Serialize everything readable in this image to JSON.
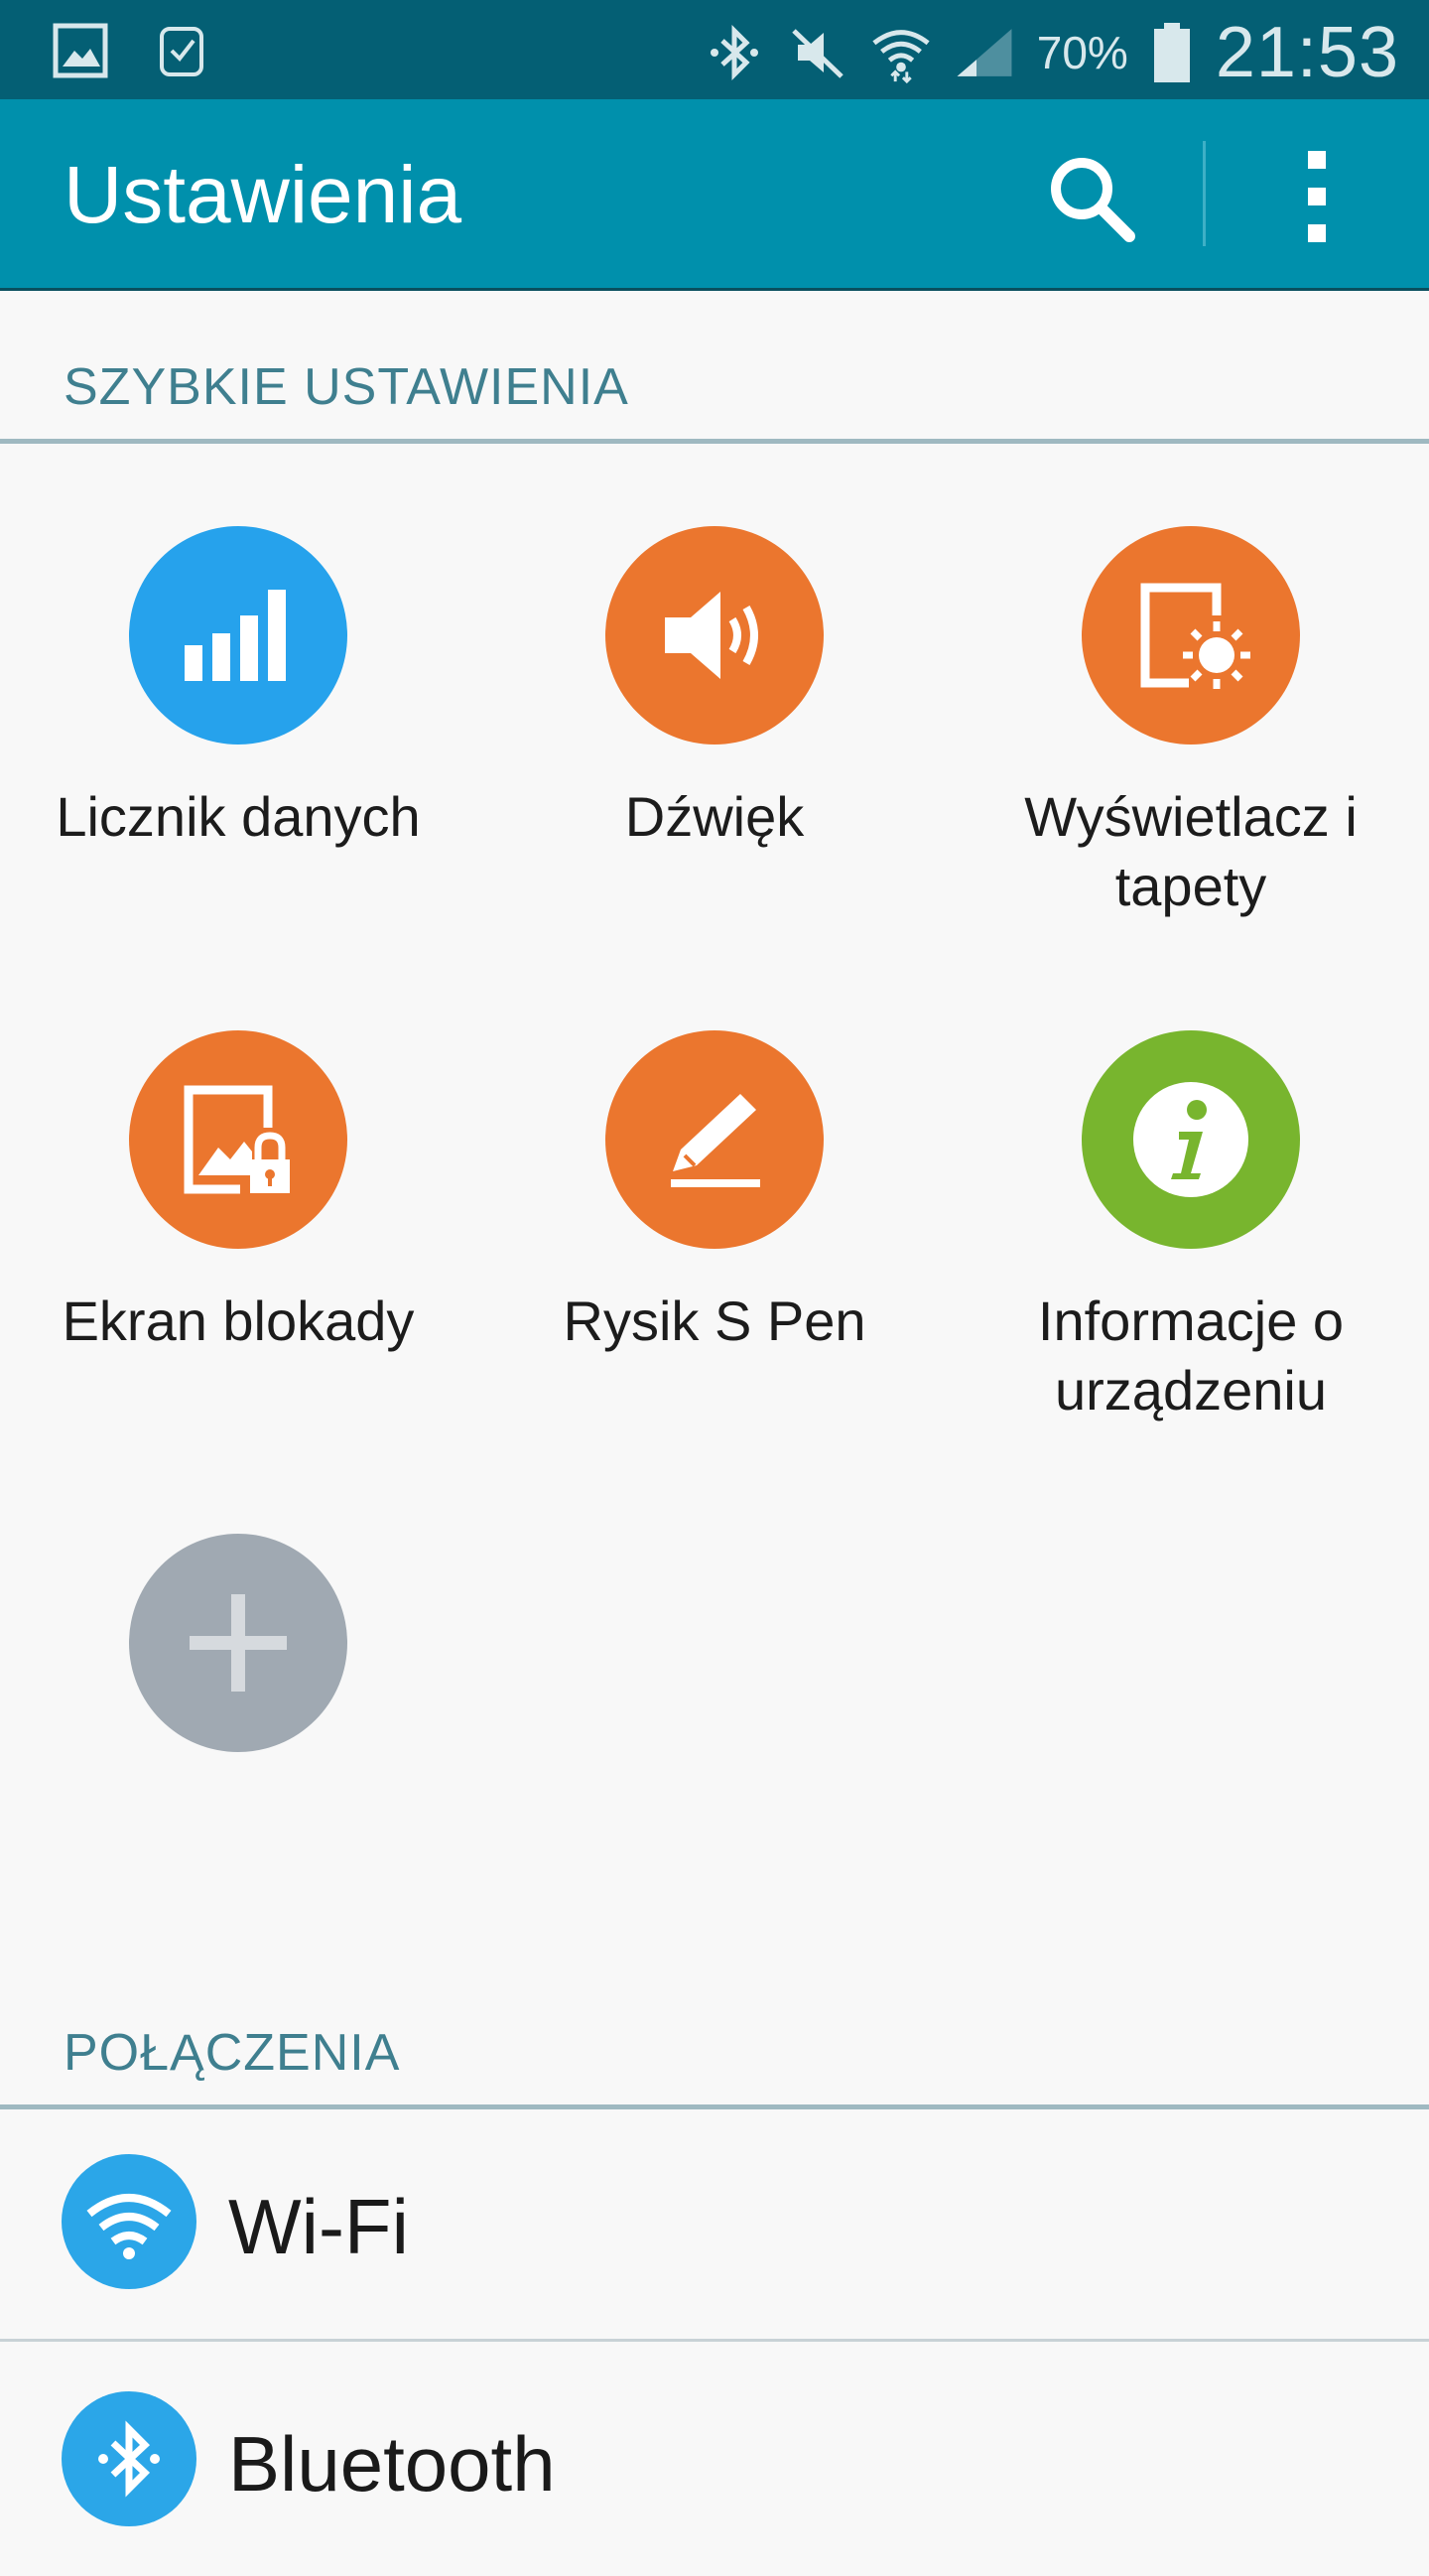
{
  "status_bar": {
    "battery": "70%",
    "time": "21:53",
    "icons": [
      "gallery-notification-icon",
      "watch-notification-icon",
      "bluetooth-icon",
      "mute-icon",
      "wifi-signal-icon",
      "cell-signal-icon",
      "battery-icon"
    ]
  },
  "app_bar": {
    "title": "Ustawienia",
    "icons": [
      "search-icon",
      "overflow-menu-icon"
    ]
  },
  "quick_settings": {
    "header": "SZYBKIE USTAWIENIA",
    "tiles": [
      {
        "label": "Licznik danych",
        "icon": "data-usage-icon",
        "color": "#26a2ec"
      },
      {
        "label": "Dźwięk",
        "icon": "sound-icon",
        "color": "#eb762e"
      },
      {
        "label": "Wyświetlacz i tapety",
        "icon": "display-wallpaper-icon",
        "color": "#eb762e"
      },
      {
        "label": "Ekran blokady",
        "icon": "lock-screen-icon",
        "color": "#eb762e"
      },
      {
        "label": "Rysik S Pen",
        "icon": "s-pen-icon",
        "color": "#eb762e"
      },
      {
        "label": "Informacje o urządzeniu",
        "icon": "info-icon",
        "color": "#78b52e"
      },
      {
        "label": "",
        "icon": "add-icon",
        "color": "#a0a9b2"
      }
    ]
  },
  "connections": {
    "header": "POŁĄCZENIA",
    "items": [
      {
        "label": "Wi-Fi",
        "icon": "wifi-icon"
      },
      {
        "label": "Bluetooth",
        "icon": "bluetooth-icon"
      }
    ]
  },
  "colors": {
    "status_bar_bg": "#045f74",
    "app_bar_bg": "#0090ac",
    "accent_blue": "#26a2ec",
    "accent_orange": "#eb762e",
    "accent_green": "#78b52e",
    "section_text": "#3f7f8f"
  }
}
